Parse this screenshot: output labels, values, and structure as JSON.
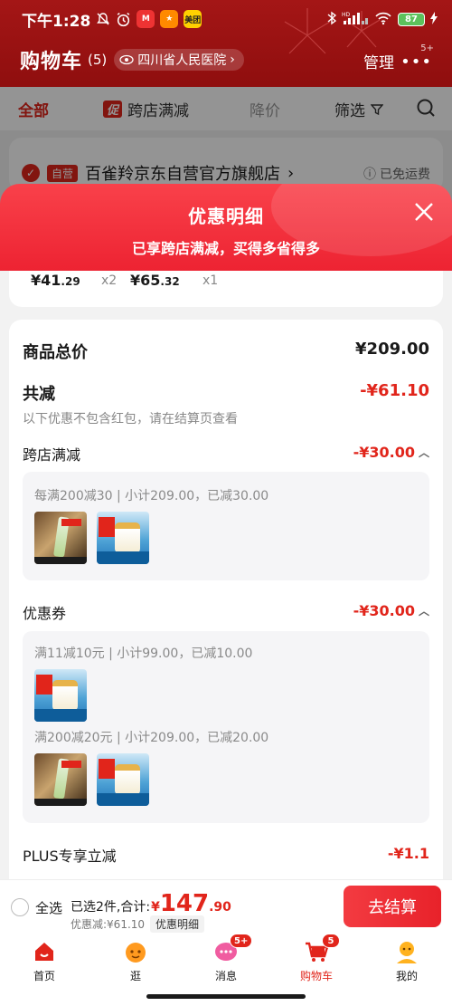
{
  "status_bar": {
    "time": "下午1:28",
    "app_badge_meituan": "美团",
    "battery": "87",
    "hd": "HD"
  },
  "header": {
    "title": "购物车",
    "count": "(5)",
    "location": "四川省人民医院",
    "manage": "管理",
    "more_badge": "5+"
  },
  "tabs": {
    "all": "全部",
    "promo_tag": "促",
    "cross_store": "跨店满减",
    "price_drop": "降价",
    "filter": "筛选"
  },
  "store": {
    "self_tag": "自营",
    "name": "百雀羚京东自营官方旗舰店",
    "shipping": "已免运费"
  },
  "sheet": {
    "title": "优惠明细",
    "subtitle": "已享跨店满减，买得多省得多"
  },
  "item_prices": [
    {
      "int": "¥41",
      "dec": ".29",
      "qty": "x2"
    },
    {
      "int": "¥65",
      "dec": ".32",
      "qty": "x1"
    }
  ],
  "detail": {
    "total_label": "商品总价",
    "total_value": "¥209.00",
    "reduce_label": "共减",
    "reduce_value": "-¥61.10",
    "reduce_note": "以下优惠不包含红包，请在结算页查看",
    "cross_label": "跨店满减",
    "cross_value": "-¥30.00",
    "cross_rule": "每满200减30 | 小计209.00，已减30.00",
    "coupon_label": "优惠券",
    "coupon_value": "-¥30.00",
    "coupon_rule_1": "满11减10元 | 小计99.00，已减10.00",
    "coupon_rule_2": "满200减20元 | 小计209.00，已减20.00",
    "plus_label": "PLUS专享立减",
    "plus_value": "-¥1.1"
  },
  "settle": {
    "select_all": "全选",
    "selected_text": "已选2件,合计:",
    "yen": "¥",
    "sum_int": "147",
    "sum_dec": ".90",
    "discount_text": "优惠减:¥61.10",
    "discount_btn": "优惠明细",
    "checkout": "去结算"
  },
  "tabbar": {
    "home": "首页",
    "browse": "逛",
    "messages": "消息",
    "messages_badge": "5+",
    "cart": "购物车",
    "cart_badge": "5",
    "mine": "我的"
  },
  "colors": {
    "accent": "#e1251b",
    "header_bg": "#8f0e0e",
    "sheet_head": "#ed2332"
  }
}
